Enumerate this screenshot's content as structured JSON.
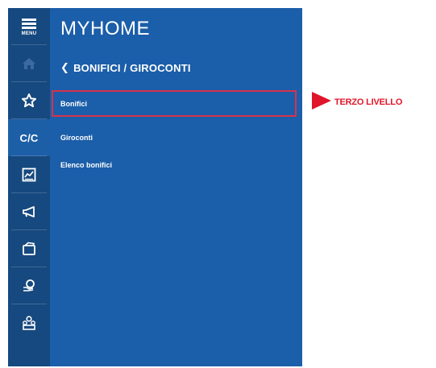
{
  "rail": {
    "menu_label": "MENU",
    "cc_label": "C/C",
    "icons": [
      "menu-icon",
      "home-icon",
      "star-icon",
      "current-account-icon",
      "chart-icon",
      "megaphone-icon",
      "cards-icon",
      "coins-icon",
      "people-icon"
    ]
  },
  "panel": {
    "brand": "MYHOME",
    "breadcrumb": "BONIFICI / GIROCONTI",
    "items": [
      {
        "label": "Bonifici"
      },
      {
        "label": "Giroconti"
      },
      {
        "label": "Elenco bonifici"
      }
    ]
  },
  "annotation": {
    "label": "TERZO LIVELLO",
    "color": "#e0152a"
  },
  "colors": {
    "rail_bg": "#16497f",
    "panel_bg": "#1b5ea9",
    "highlight_border": "#d8324b"
  }
}
